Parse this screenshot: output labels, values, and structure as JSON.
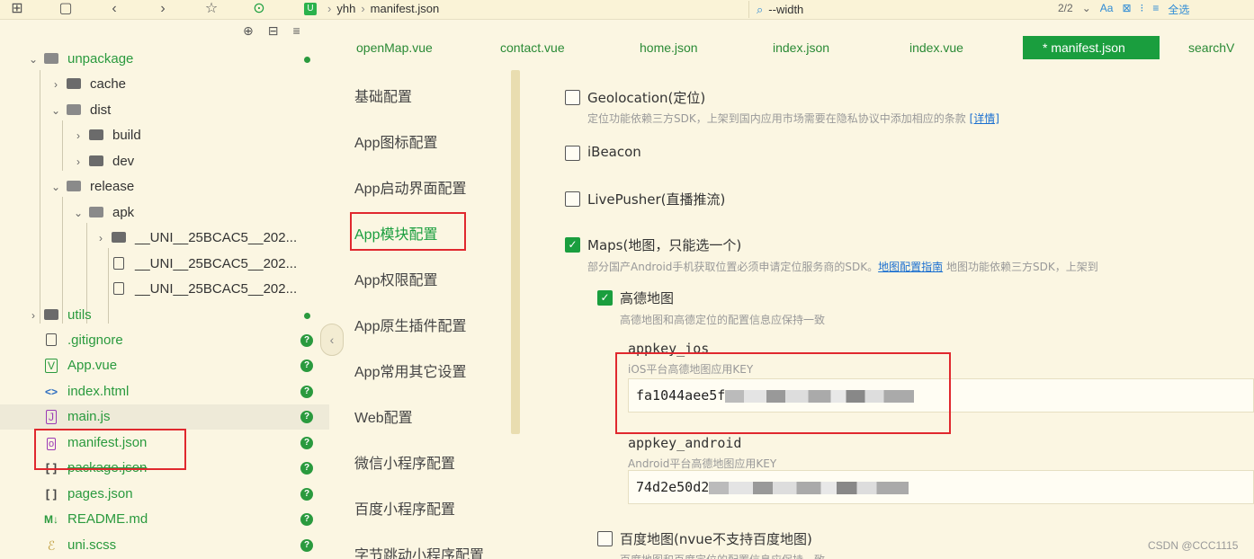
{
  "toolbar": {
    "breadcrumb": [
      "yhh",
      "manifest.json"
    ],
    "search_value": "--width",
    "match_count": "2/2",
    "right_items": [
      "Aa",
      "全选"
    ]
  },
  "tree": {
    "rows": [
      {
        "label": "unpackage",
        "kind": "folder-open",
        "depth": 0,
        "chev": "⌄",
        "badge": "dot",
        "green": true
      },
      {
        "label": "cache",
        "kind": "folder",
        "depth": 1,
        "chev": "›"
      },
      {
        "label": "dist",
        "kind": "folder-open",
        "depth": 1,
        "chev": "⌄"
      },
      {
        "label": "build",
        "kind": "folder",
        "depth": 2,
        "chev": "›"
      },
      {
        "label": "dev",
        "kind": "folder",
        "depth": 2,
        "chev": "›"
      },
      {
        "label": "release",
        "kind": "folder-open",
        "depth": 1,
        "chev": "⌄"
      },
      {
        "label": "apk",
        "kind": "folder-open",
        "depth": 2,
        "chev": "⌄"
      },
      {
        "label": "__UNI__25BCAC5__202...",
        "kind": "folder",
        "depth": 3,
        "chev": "›"
      },
      {
        "label": "__UNI__25BCAC5__202...",
        "kind": "file",
        "depth": 3,
        "chev": ""
      },
      {
        "label": "__UNI__25BCAC5__202...",
        "kind": "file",
        "depth": 3,
        "chev": ""
      },
      {
        "label": "utils",
        "kind": "folder",
        "depth": 0,
        "chev": "›",
        "badge": "dot",
        "green": true
      },
      {
        "label": ".gitignore",
        "kind": "file",
        "depth": 0,
        "chev": "",
        "badge": "q",
        "green": true
      },
      {
        "label": "App.vue",
        "kind": "vue",
        "depth": 0,
        "chev": "",
        "badge": "q",
        "green": true
      },
      {
        "label": "index.html",
        "kind": "html",
        "depth": 0,
        "chev": "",
        "badge": "q",
        "green": true
      },
      {
        "label": "main.js",
        "kind": "js",
        "depth": 0,
        "chev": "",
        "badge": "q",
        "green": true,
        "selected": true
      },
      {
        "label": "manifest.json",
        "kind": "manifest",
        "depth": 0,
        "chev": "",
        "badge": "q",
        "green": true
      },
      {
        "label": "package.json",
        "kind": "json",
        "depth": 0,
        "chev": "",
        "badge": "q",
        "green": true,
        "strike": true
      },
      {
        "label": "pages.json",
        "kind": "json",
        "depth": 0,
        "chev": "",
        "badge": "q",
        "green": true
      },
      {
        "label": "README.md",
        "kind": "md",
        "depth": 0,
        "chev": "",
        "badge": "q",
        "green": true
      },
      {
        "label": "uni.scss",
        "kind": "scss",
        "depth": 0,
        "chev": "",
        "badge": "q",
        "green": true
      }
    ]
  },
  "tabs": [
    "openMap.vue",
    "contact.vue",
    "home.json",
    "index.json",
    "index.vue",
    "* manifest.json",
    "searchV"
  ],
  "nav": [
    "基础配置",
    "App图标配置",
    "App启动界面配置",
    "App模块配置",
    "App权限配置",
    "App原生插件配置",
    "App常用其它设置",
    "Web配置",
    "微信小程序配置",
    "百度小程序配置",
    "字节跳动小程序配置"
  ],
  "content": {
    "geolocation": {
      "label": "Geolocation(定位)",
      "desc": "定位功能依赖三方SDK，上架到国内应用市场需要在隐私协议中添加相应的条款",
      "link": "[详情]",
      "checked": false
    },
    "ibeacon": {
      "label": "iBeacon",
      "checked": false
    },
    "livepusher": {
      "label": "LivePusher(直播推流)",
      "checked": false
    },
    "maps": {
      "label": "Maps(地图，只能选一个)",
      "desc": "部分国产Android手机获取位置必须申请定位服务商的SDK。",
      "link": "地图配置指南",
      "desc2": "地图功能依赖三方SDK，上架到",
      "checked": true
    },
    "amap": {
      "label": "高德地图",
      "desc": "高德地图和高德定位的配置信息应保持一致",
      "checked": true
    },
    "appkey_ios": {
      "label": "appkey_ios",
      "desc": "iOS平台高德地图应用KEY",
      "value": "fa1044aee5f"
    },
    "appkey_android": {
      "label": "appkey_android",
      "desc": "Android平台高德地图应用KEY",
      "value": "74d2e50d2"
    },
    "baidu": {
      "label": "百度地图(nvue不支持百度地图)",
      "desc": "百度地图和百度定位的配置信息应保持一致",
      "checked": false
    }
  },
  "watermark": "CSDN @CCC1115"
}
